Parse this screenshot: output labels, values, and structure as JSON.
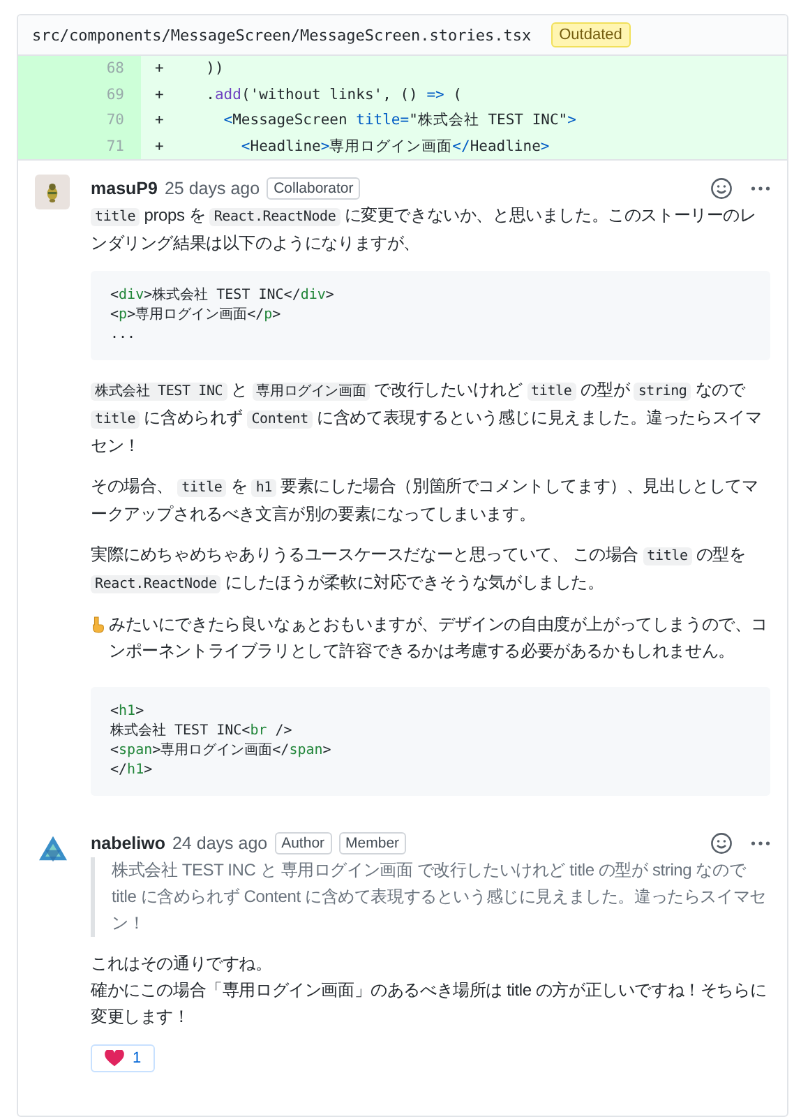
{
  "file_header": {
    "path": "src/components/MessageScreen/MessageScreen.stories.tsx",
    "badge": "Outdated"
  },
  "diff_lines": [
    {
      "number": "68",
      "sign": "+",
      "segments": [
        {
          "kind": "text",
          "text": "  ))"
        }
      ]
    },
    {
      "number": "69",
      "sign": "+",
      "segments": [
        {
          "kind": "text",
          "text": "  ."
        },
        {
          "kind": "fn",
          "text": "add"
        },
        {
          "kind": "text",
          "text": "('without links', () "
        },
        {
          "kind": "keyword",
          "text": "=>"
        },
        {
          "kind": "text",
          "text": " ("
        }
      ]
    },
    {
      "number": "70",
      "sign": "+",
      "segments": [
        {
          "kind": "keyword",
          "text": "    <"
        },
        {
          "kind": "text",
          "text": "MessageScreen "
        },
        {
          "kind": "keyword",
          "text": "title="
        },
        {
          "kind": "text",
          "text": "\"株式会社 TEST INC\""
        },
        {
          "kind": "keyword",
          "text": ">"
        }
      ]
    },
    {
      "number": "71",
      "sign": "+",
      "segments": [
        {
          "kind": "keyword",
          "text": "      <"
        },
        {
          "kind": "text",
          "text": "Headline"
        },
        {
          "kind": "keyword",
          "text": ">"
        },
        {
          "kind": "text",
          "text": "専用ログイン画面"
        },
        {
          "kind": "keyword",
          "text": "</"
        },
        {
          "kind": "text",
          "text": "Headline"
        },
        {
          "kind": "keyword",
          "text": ">"
        }
      ]
    }
  ],
  "comments": [
    {
      "author": "masuP9",
      "time": "25 days ago",
      "avatar": {
        "kind": "picture"
      },
      "labels": [
        "Collaborator"
      ],
      "blocks": [
        {
          "kind": "paragraph",
          "segments": [
            {
              "kind": "code",
              "text": "title"
            },
            {
              "kind": "text",
              "text": " props を "
            },
            {
              "kind": "code",
              "text": "React.ReactNode"
            },
            {
              "kind": "text",
              "text": " に変更できないか、と思いました。このストーリーのレンダリング結果は以下のようになりますが、"
            }
          ]
        },
        {
          "kind": "codeblock",
          "lines": [
            [
              {
                "kind": "text",
                "text": "<"
              },
              {
                "kind": "tag",
                "text": "div"
              },
              {
                "kind": "text",
                "text": ">株式会社 TEST INC</"
              },
              {
                "kind": "tag",
                "text": "div"
              },
              {
                "kind": "text",
                "text": ">"
              }
            ],
            [
              {
                "kind": "text",
                "text": "<"
              },
              {
                "kind": "tag",
                "text": "p"
              },
              {
                "kind": "text",
                "text": ">専用ログイン画面</"
              },
              {
                "kind": "tag",
                "text": "p"
              },
              {
                "kind": "text",
                "text": ">"
              }
            ],
            [
              {
                "kind": "text",
                "text": "..."
              }
            ]
          ]
        },
        {
          "kind": "paragraph",
          "segments": [
            {
              "kind": "code",
              "text": "株式会社 TEST INC"
            },
            {
              "kind": "text",
              "text": " と "
            },
            {
              "kind": "code",
              "text": "専用ログイン画面"
            },
            {
              "kind": "text",
              "text": " で改行したいけれど "
            },
            {
              "kind": "code",
              "text": "title"
            },
            {
              "kind": "text",
              "text": " の型が "
            },
            {
              "kind": "code",
              "text": "string"
            },
            {
              "kind": "text",
              "text": " なので "
            },
            {
              "kind": "code",
              "text": "title"
            },
            {
              "kind": "text",
              "text": " に含められず "
            },
            {
              "kind": "code",
              "text": "Content"
            },
            {
              "kind": "text",
              "text": " に含めて表現するという感じに見えました。違ったらスイマセン！"
            }
          ]
        },
        {
          "kind": "paragraph",
          "segments": [
            {
              "kind": "text",
              "text": "その場合、 "
            },
            {
              "kind": "code",
              "text": "title"
            },
            {
              "kind": "text",
              "text": " を "
            },
            {
              "kind": "code",
              "text": "h1"
            },
            {
              "kind": "text",
              "text": " 要素にした場合（別箇所でコメントしてます）、見出しとしてマークアップされるべき文言が別の要素になってしまいます。"
            }
          ]
        },
        {
          "kind": "paragraph",
          "segments": [
            {
              "kind": "text",
              "text": "実際にめちゃめちゃありうるユースケースだなーと思っていて、 この場合 "
            },
            {
              "kind": "code",
              "text": "title"
            },
            {
              "kind": "text",
              "text": " の型を "
            },
            {
              "kind": "code",
              "text": "React.ReactNode"
            },
            {
              "kind": "text",
              "text": " にしたほうが柔軟に対応できそうな気がしました。"
            }
          ]
        },
        {
          "kind": "hand_paragraph",
          "segments": [
            {
              "kind": "text",
              "text": " みたいにできたら良いなぁとおもいますが、デザインの自由度が上がってしまうので、コンポーネントライブラリとして許容できるかは考慮する必要があるかもしれません。"
            }
          ]
        },
        {
          "kind": "codeblock",
          "lines": [
            [
              {
                "kind": "text",
                "text": "<"
              },
              {
                "kind": "tag",
                "text": "h1"
              },
              {
                "kind": "text",
                "text": ">"
              }
            ],
            [
              {
                "kind": "text",
                "text": "株式会社 TEST INC<"
              },
              {
                "kind": "tag",
                "text": "br"
              },
              {
                "kind": "text",
                "text": " />"
              }
            ],
            [
              {
                "kind": "text",
                "text": "<"
              },
              {
                "kind": "tag",
                "text": "span"
              },
              {
                "kind": "text",
                "text": ">専用ログイン画面</"
              },
              {
                "kind": "tag",
                "text": "span"
              },
              {
                "kind": "text",
                "text": ">"
              }
            ],
            [
              {
                "kind": "text",
                "text": "</"
              },
              {
                "kind": "tag",
                "text": "h1"
              },
              {
                "kind": "text",
                "text": ">"
              }
            ]
          ]
        }
      ]
    },
    {
      "author": "nabeliwo",
      "time": "24 days ago",
      "avatar": {
        "kind": "logo"
      },
      "labels": [
        "Author",
        "Member"
      ],
      "reactions": [
        {
          "kind": "heart",
          "count": "1"
        }
      ],
      "blocks": [
        {
          "kind": "quote",
          "segments": [
            {
              "kind": "text",
              "text": "株式会社 TEST INC と 専用ログイン画面 で改行したいけれど title の型が string なので title に含められず Content に含めて表現するという感じに見えました。違ったらスイマセン！"
            }
          ]
        },
        {
          "kind": "paragraph",
          "segments": [
            {
              "kind": "text",
              "text": "これはその通りですね。"
            },
            {
              "kind": "break"
            },
            {
              "kind": "text",
              "text": "確かにこの場合「専用ログイン画面」のあるべき場所は title の方が正しいですね！そちらに変更します！"
            }
          ]
        }
      ]
    }
  ]
}
